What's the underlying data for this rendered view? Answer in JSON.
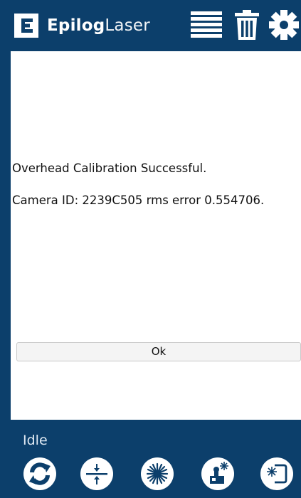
{
  "header": {
    "brand_bold": "Epilog",
    "brand_light": "Laser",
    "icons": {
      "logo": "epilog-logo-icon",
      "job_list": "job-list-icon",
      "trash": "trash-icon",
      "settings": "gear-icon"
    }
  },
  "dialog": {
    "line1": "Overhead Calibration Successful.",
    "line2": "Camera ID: 2239C505 rms error 0.554706.",
    "ok_label": "Ok"
  },
  "footer": {
    "status": "Idle",
    "icons": [
      "refresh-icon",
      "focus-icon",
      "laser-icon",
      "jog-icon",
      "frame-icon"
    ]
  },
  "colors": {
    "brand_blue": "#0c3f6b",
    "panel": "#ffffff"
  }
}
